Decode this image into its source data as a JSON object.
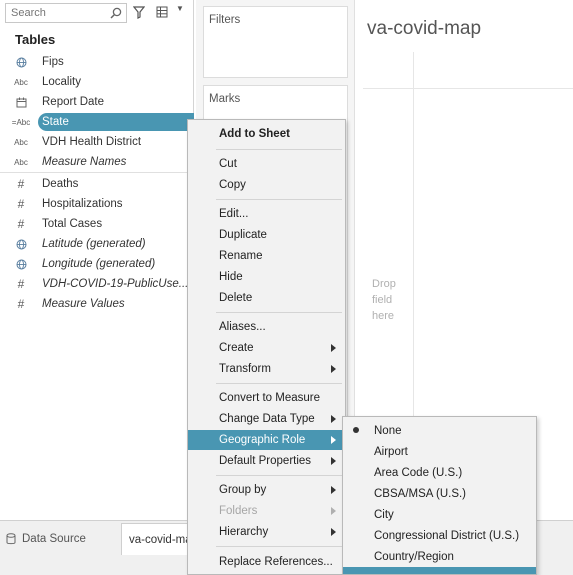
{
  "data_pane": {
    "search_placeholder": "Search",
    "tables_heading": "Tables",
    "dimensions": [
      {
        "label": "Fips",
        "type": "globe",
        "italic": false
      },
      {
        "label": "Locality",
        "type": "Abc",
        "italic": false
      },
      {
        "label": "Report Date",
        "type": "calendar",
        "italic": false
      },
      {
        "label": "State",
        "type": "=Abc",
        "italic": false,
        "selected": true
      },
      {
        "label": "VDH Health District",
        "type": "Abc",
        "italic": false
      },
      {
        "label": "Measure Names",
        "type": "Abc",
        "italic": true
      }
    ],
    "measures": [
      {
        "label": "Deaths",
        "type": "#",
        "italic": false
      },
      {
        "label": "Hospitalizations",
        "type": "#",
        "italic": false
      },
      {
        "label": "Total Cases",
        "type": "#",
        "italic": false
      },
      {
        "label": "Latitude (generated)",
        "type": "globe",
        "italic": true
      },
      {
        "label": "Longitude (generated)",
        "type": "globe",
        "italic": true
      },
      {
        "label": "VDH-COVID-19-PublicUse...",
        "type": "#",
        "italic": true
      },
      {
        "label": "Measure Values",
        "type": "#",
        "italic": true
      }
    ]
  },
  "shelves": {
    "filters_title": "Filters",
    "marks_title": "Marks"
  },
  "view": {
    "sheet_title": "va-covid-map",
    "drop_hint": "Drop field here"
  },
  "tabs": {
    "data_source": "Data Source",
    "sheet": "va-covid-map"
  },
  "context_menu": [
    {
      "label": "Add to Sheet",
      "bold": true
    },
    {
      "separator": true
    },
    {
      "label": "Cut"
    },
    {
      "label": "Copy"
    },
    {
      "separator": true
    },
    {
      "label": "Edit..."
    },
    {
      "label": "Duplicate"
    },
    {
      "label": "Rename"
    },
    {
      "label": "Hide"
    },
    {
      "label": "Delete"
    },
    {
      "separator": true
    },
    {
      "label": "Aliases..."
    },
    {
      "label": "Create",
      "submenu": true
    },
    {
      "label": "Transform",
      "submenu": true
    },
    {
      "separator": true
    },
    {
      "label": "Convert to Measure"
    },
    {
      "label": "Change Data Type",
      "submenu": true
    },
    {
      "label": "Geographic Role",
      "submenu": true,
      "highlighted": true
    },
    {
      "label": "Default Properties",
      "submenu": true
    },
    {
      "separator": true
    },
    {
      "label": "Group by",
      "submenu": true
    },
    {
      "label": "Folders",
      "submenu": true,
      "disabled": true
    },
    {
      "label": "Hierarchy",
      "submenu": true
    },
    {
      "separator": true
    },
    {
      "label": "Replace References..."
    }
  ],
  "geographic_role_submenu": [
    {
      "label": "None",
      "checked": true
    },
    {
      "label": "Airport"
    },
    {
      "label": "Area Code (U.S.)"
    },
    {
      "label": "CBSA/MSA (U.S.)"
    },
    {
      "label": "City"
    },
    {
      "label": "Congressional District (U.S.)"
    },
    {
      "label": "Country/Region"
    },
    {
      "label": "",
      "highlighted": true
    }
  ],
  "colors": {
    "selection": "#4996b2",
    "menu_bg": "#f2f2f2",
    "shelf_bg": "#f5f5f5"
  },
  "icons": {
    "search": "search-icon",
    "filter": "filter-icon",
    "view_toggle": "view-toggle-icon",
    "data_source": "database-icon"
  }
}
